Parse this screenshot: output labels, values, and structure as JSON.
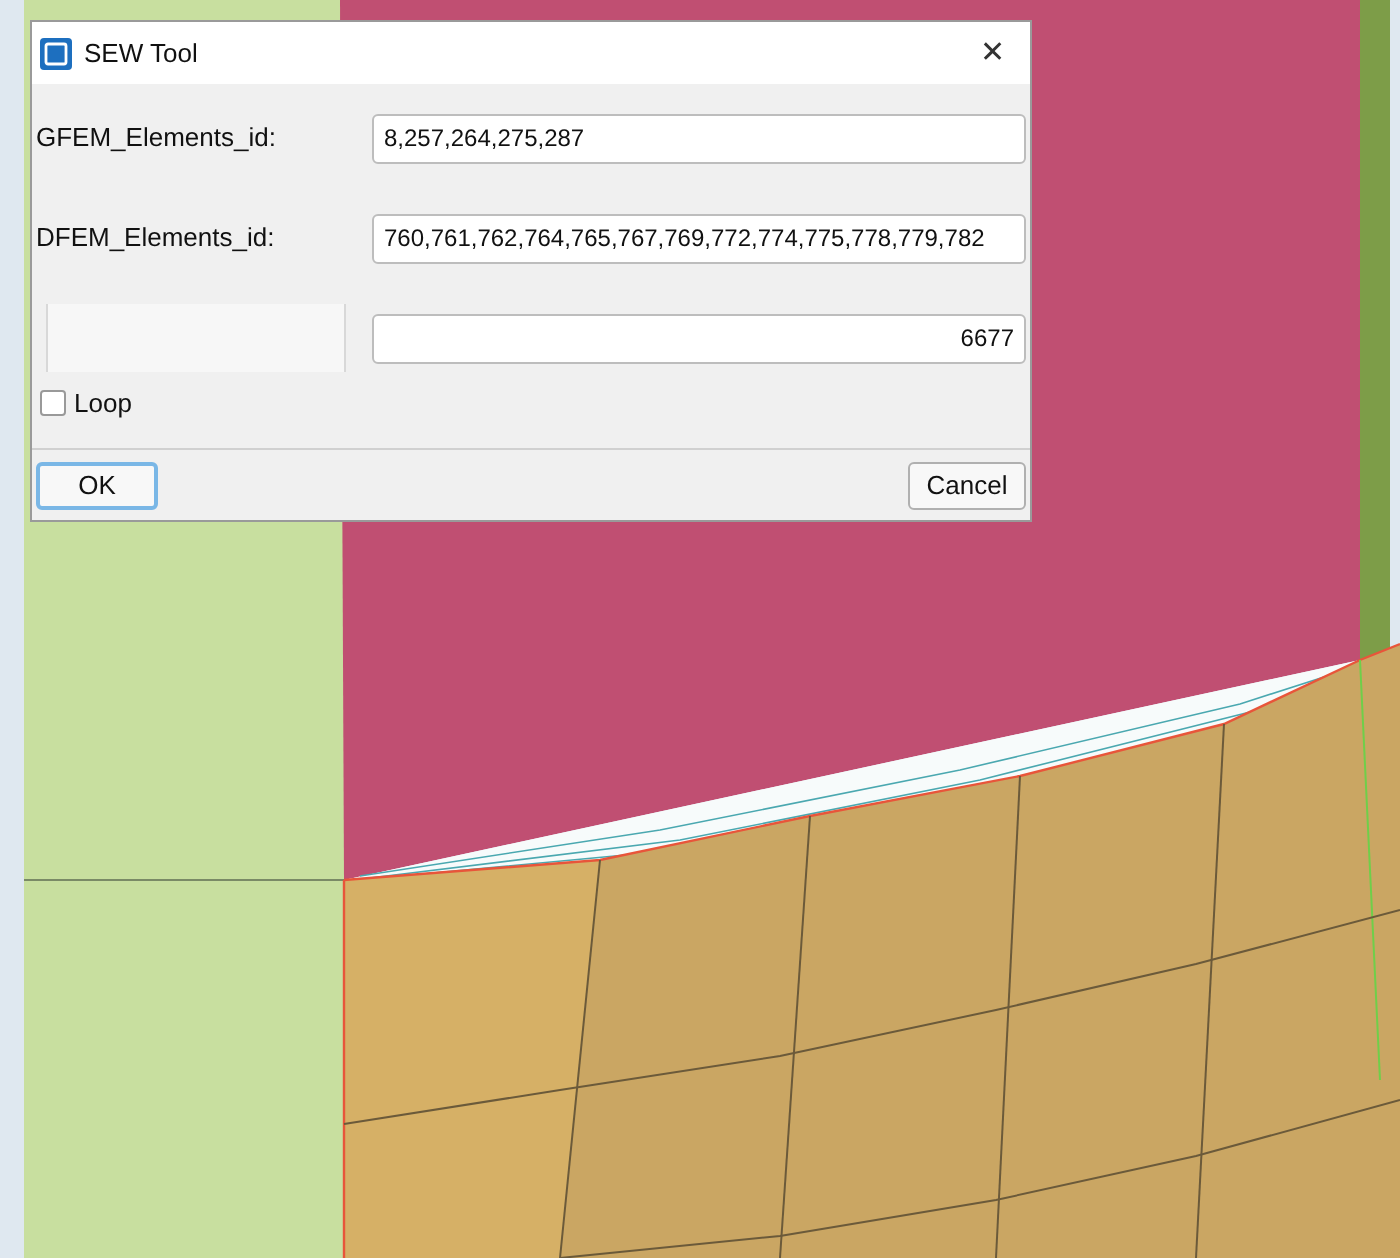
{
  "window": {
    "title": "SEW Tool",
    "close": "✕"
  },
  "fields": [
    {
      "label": "GFEM_Elements_id:",
      "value": "8,257,264,275,287",
      "kind": "text"
    },
    {
      "label": "DFEM_Elements_id:",
      "value": "760,761,762,764,765,767,769,772,774,775,778,779,782",
      "kind": "text"
    },
    {
      "value": "6677",
      "kind": "number"
    }
  ],
  "loop": {
    "label": "Loop",
    "checked": false
  },
  "buttons": [
    {
      "label": "OK",
      "focused": true
    },
    {
      "label": "Cancel",
      "focused": false
    }
  ]
}
